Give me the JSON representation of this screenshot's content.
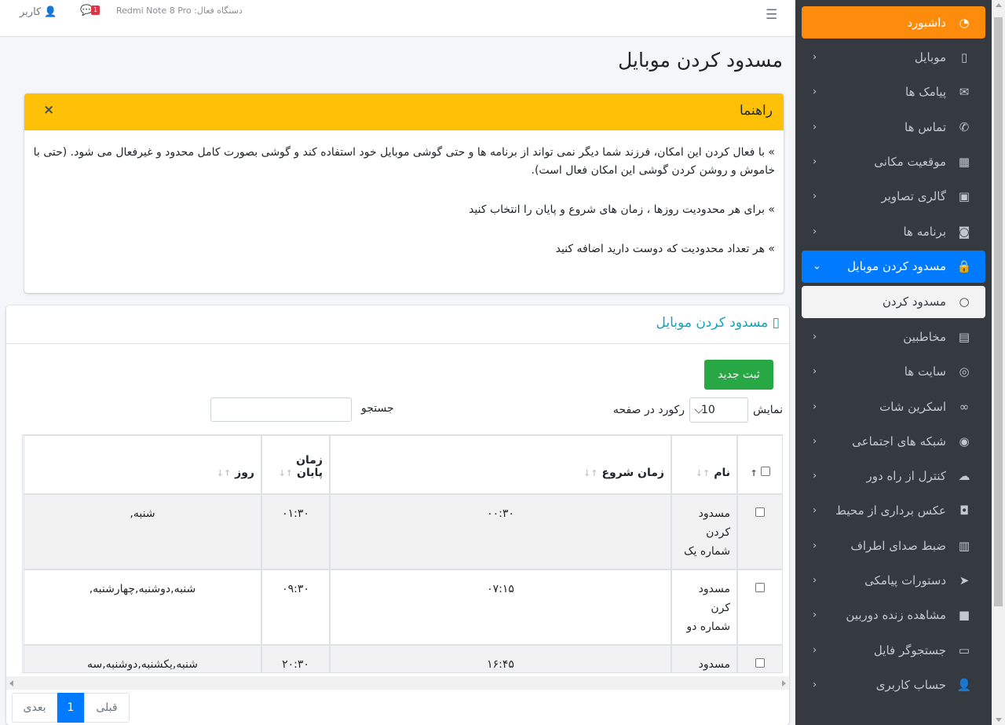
{
  "topbar": {
    "device_label": "دستگاه فعال: Redmi Note 8 Pro",
    "messages_badge": "1",
    "user_label": "کاربر"
  },
  "sidebar": {
    "items": [
      {
        "label": "داشبورد",
        "icon": "gauge-icon"
      },
      {
        "label": "موبایل",
        "icon": "mobile-icon"
      },
      {
        "label": "پیامک ها",
        "icon": "envelope-icon"
      },
      {
        "label": "تماس ها",
        "icon": "phone-icon"
      },
      {
        "label": "موقعیت مکانی",
        "icon": "map-icon"
      },
      {
        "label": "گالری تصاویر",
        "icon": "image-icon"
      },
      {
        "label": "برنامه ها",
        "icon": "gamepad-icon"
      },
      {
        "label": "مسدود کردن موبایل",
        "icon": "lock-icon"
      },
      {
        "label": "مسدود کردن",
        "icon": "circle-icon"
      },
      {
        "label": "مخاطبین",
        "icon": "book-icon"
      },
      {
        "label": "سایت ها",
        "icon": "chrome-icon"
      },
      {
        "label": "اسکرین شات",
        "icon": "binoculars-icon"
      },
      {
        "label": "شبکه های اجتماعی",
        "icon": "eye-icon"
      },
      {
        "label": "کنترل از راه دور",
        "icon": "cloud-icon"
      },
      {
        "label": "عکس برداری از محیط",
        "icon": "camera-icon"
      },
      {
        "label": "ضبط صدای اطراف",
        "icon": "audio-file-icon"
      },
      {
        "label": "دستورات پیامکی",
        "icon": "paper-plane-icon"
      },
      {
        "label": "مشاهده زنده دوربین",
        "icon": "video-icon"
      },
      {
        "label": "جستجوگر فایل",
        "icon": "folder-icon"
      },
      {
        "label": "حساب کاربری",
        "icon": "user-icon"
      }
    ]
  },
  "page": {
    "title": "مسدود کردن موبایل"
  },
  "guide": {
    "title": "راهنما",
    "close": "×",
    "lines": [
      "» با فعال کردن این امکان، فرزند شما دیگر نمی تواند از برنامه ها و حتی گوشی موبایل خود استفاده کند و گوشی بصورت کامل محدود و غیرفعال می شود. (حتی با خاموش و روشن کردن گوشی این امکان فعال است).",
      "» برای هر محدودیت روزها ، زمان های شروع و پایان را انتخاب کنید",
      "» هر تعداد محدودیت که دوست دارید اضافه کنید"
    ]
  },
  "card": {
    "title": "مسدود کردن موبایل",
    "new_button": "ثبت جدید",
    "length_prefix": "نمایش",
    "length_value": "10",
    "length_suffix": "رکورد در صفحه",
    "search_label": "جستجو",
    "columns": [
      "نام",
      "زمان شروع",
      "زمان پایان",
      "روز"
    ],
    "rows": [
      {
        "name": "مسدود کردن شماره یک",
        "start": "۰۰:۳۰",
        "end": "۰۱:۳۰",
        "days": "شنبه,"
      },
      {
        "name": "مسدود کرن شماره دو",
        "start": "۰۷:۱۵",
        "end": "۰۹:۳۰",
        "days": "شنبه,دوشنبه,چهارشنبه,"
      },
      {
        "name": "مسدود کردن شماره سه",
        "start": "۱۶:۴۵",
        "end": "۲۰:۳۰",
        "days": "شنبه,یکشنبه,دوشنبه,سه شنبه,چهارشنبه,پنجشنبه,جمعه,"
      }
    ],
    "pager": {
      "prev": "قبلی",
      "current": "1",
      "next": "بعدی"
    }
  }
}
